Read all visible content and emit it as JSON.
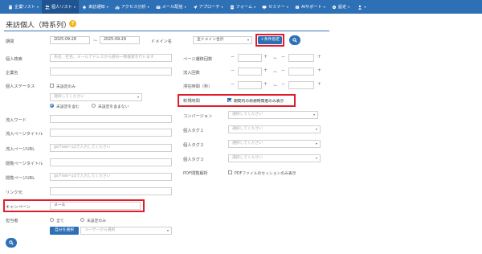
{
  "nav": {
    "items": [
      {
        "label": "企業リスト",
        "icon": "building-icon",
        "caret": "▾",
        "active": false
      },
      {
        "label": "個人リスト",
        "icon": "users-icon",
        "caret": "▾",
        "active": true
      },
      {
        "label": "来訪通知",
        "icon": "bell-icon",
        "caret": "▾",
        "active": false
      },
      {
        "label": "アクセス分析",
        "icon": "chart-icon",
        "caret": "▾",
        "active": false
      },
      {
        "label": "メール配信",
        "icon": "mail-icon",
        "caret": "▾",
        "active": false
      },
      {
        "label": "アプローチ",
        "icon": "send-icon",
        "caret": "▾",
        "active": false
      },
      {
        "label": "フォーム",
        "icon": "form-icon",
        "caret": "▾",
        "active": false
      },
      {
        "label": "セミナー",
        "icon": "seminar-icon",
        "caret": "▾",
        "active": false
      },
      {
        "label": "AIサポート",
        "icon": "ai-icon",
        "caret": "▾",
        "active": false
      },
      {
        "label": "設定",
        "icon": "gear-icon",
        "caret": "▾",
        "active": false
      }
    ],
    "user_caret": "▾"
  },
  "page": {
    "title": "来訪個人（時系列）",
    "help": "?"
  },
  "left": {
    "period_label": "期間",
    "date_from": "2025-09-28",
    "range_sep": "〜",
    "date_to": "2025-09-29",
    "person_search_label": "個人検索",
    "person_search_placeholder": "氏名、社名、メールアドレスから部分一致検索を行います",
    "company_label": "企業名",
    "status_label": "個人ステータス",
    "status_unset_only": "未設定のみ",
    "status_select_placeholder": "選択してください",
    "radio_include": "未設定を含む",
    "radio_exclude": "未設定を含まない",
    "inflow_word_label": "流入ワード",
    "inflow_title_label": "流入ページタイトル",
    "inflow_url_label": "流入ページURL",
    "inflow_url_placeholder": "gs/?seeへはで入力してください",
    "view_title_label": "閲覧ページタイトル",
    "view_url_label": "閲覧ページURL",
    "view_url_placeholder": "gs/?seeへはで入力してください",
    "link_label": "リンク元",
    "campaign_label": "キャンペーン",
    "campaign_value": "メール",
    "owner_label": "担当者",
    "owner_all": "全て",
    "owner_unset_only": "未設定のみ",
    "self_select_button": "自分を選択",
    "user_select_placeholder": "ユーザーから選択"
  },
  "right": {
    "domain_label": "ドメイン名",
    "domain_value": "全ドメイン合計",
    "add_condition_button": "＋条件指定",
    "pageviews_label": "ページ遷移回数",
    "inflow_count_label": "流入回数",
    "stay_time_label": "滞在時間（秒）",
    "stepper_minus": "−",
    "stepper_plus": "+",
    "range_sep": "〜",
    "new_time_label": "新規時間",
    "new_time_check": "期間内の新規時間者のみ表示",
    "conversion_label": "コンバージョン",
    "conversion_placeholder": "選択してください",
    "tag1_label": "個人タグ１",
    "tag2_label": "個人タグ２",
    "tag3_label": "個人タグ３",
    "tag_placeholder": "選択してください",
    "pdf_label": "PDF閲覧解析",
    "pdf_check": "PDFファイルのセッションのみ表示"
  },
  "colors": {
    "brand": "#2d70b5",
    "highlight": "#e01e2b",
    "help": "#f2b51b"
  }
}
